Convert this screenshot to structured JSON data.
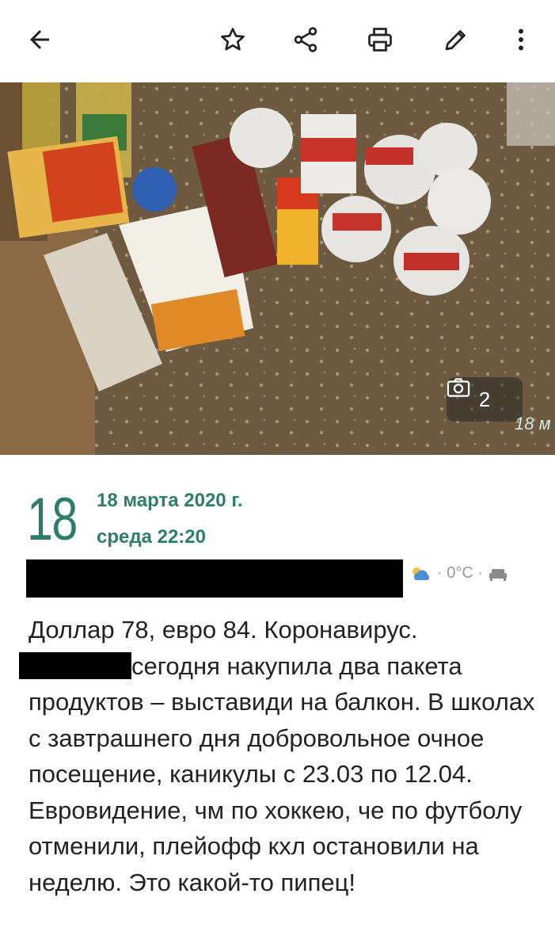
{
  "toolbar": {
    "back_icon": "arrow-left-icon",
    "star_icon": "star-icon",
    "share_icon": "share-icon",
    "print_icon": "printer-icon",
    "edit_icon": "pencil-icon",
    "more_icon": "more-vert-icon"
  },
  "photo": {
    "count": "2",
    "watermark": "18 м"
  },
  "entry": {
    "day_number": "18",
    "date_full": "18 марта 2020 г.",
    "weekday_time": "среда 22:20",
    "weather_text": "· 0°C ·",
    "weather_icon": "partly-cloudy-icon",
    "mood_icon": "sofa-icon",
    "line1": "Доллар 78, евро 84. Коронавирус.",
    "line2_after_redaction": "сегодня накупила два пакета",
    "rest": "продуктов – выставиди на балкон. В школах с завтрашнего дня добровольное очное посещение, каникулы с 23.03 по 12.04. Евровидение, чм по хоккею, че по футболу отменили, плейофф кхл остановили на неделю. Это какой-то пипец!"
  },
  "colors": {
    "accent": "#2e7d6b",
    "text": "#222222",
    "muted": "#9a9a9a"
  }
}
